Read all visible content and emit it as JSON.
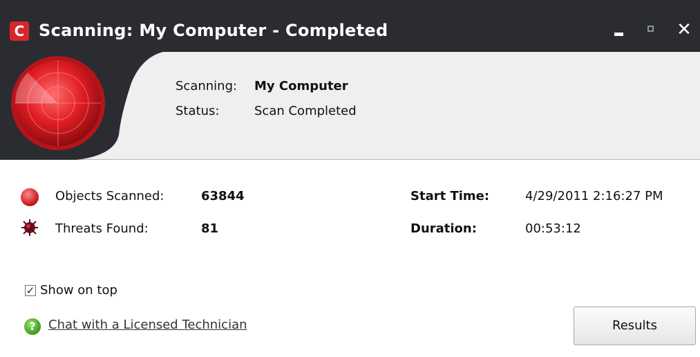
{
  "window": {
    "title": "Scanning: My Computer - Completed",
    "logo_letter": "C",
    "buttons": [
      "minimize",
      "maximize",
      "close"
    ]
  },
  "header": {
    "scanning_label": "Scanning:",
    "scanning_value": "My Computer",
    "status_label": "Status:",
    "status_value": "Scan Completed"
  },
  "stats": {
    "objects_scanned_label": "Objects Scanned:",
    "objects_scanned_value": "63844",
    "threats_found_label": "Threats Found:",
    "threats_found_value": "81",
    "start_time_label": "Start Time:",
    "start_time_value": "4/29/2011 2:16:27 PM",
    "duration_label": "Duration:",
    "duration_value": "00:53:12"
  },
  "options": {
    "show_on_top_label": "Show on top",
    "show_on_top_checked": true
  },
  "footer": {
    "chat_link": "Chat with a Licensed Technician",
    "results_button": "Results"
  },
  "colors": {
    "titlebar": "#2a2c31",
    "header_panel": "#efeff0",
    "radar_red": "#d9262b"
  }
}
